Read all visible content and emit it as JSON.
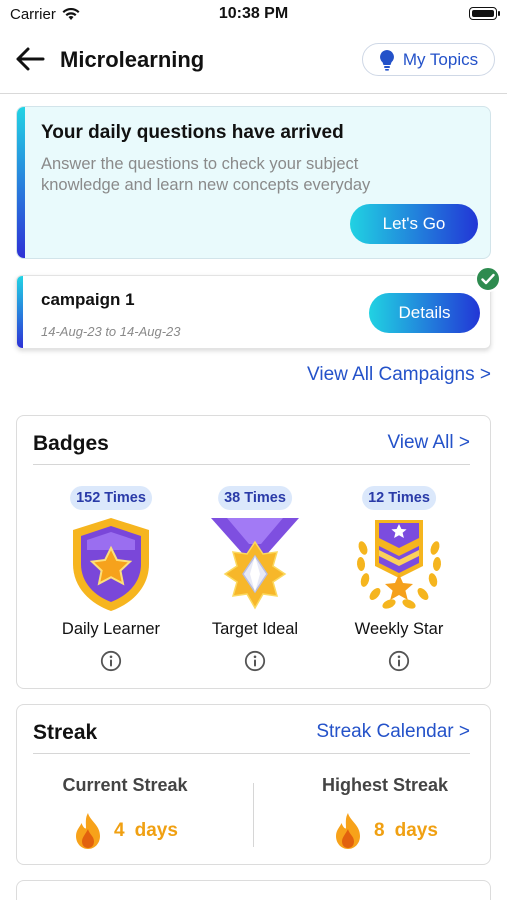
{
  "status_bar": {
    "carrier": "Carrier",
    "time": "10:38 PM"
  },
  "header": {
    "title": "Microlearning",
    "topics_label": "My Topics",
    "back_icon": "arrow-left-icon",
    "topics_icon": "lightbulb-icon"
  },
  "daily": {
    "title": "Your daily questions have arrived",
    "subtitle": "Answer the questions to check your subject knowledge and learn new concepts everyday",
    "button_label": "Let's Go"
  },
  "campaign": {
    "name": "campaign 1",
    "dates": "14-Aug-23 to 14-Aug-23",
    "button_label": "Details",
    "status_icon": "check-circle-icon"
  },
  "view_all_campaigns": "View All Campaigns >",
  "badges": {
    "title": "Badges",
    "view_all": "View All >",
    "items": [
      {
        "count": "152 Times",
        "name": "Daily Learner",
        "icon": "shield-star-badge-icon"
      },
      {
        "count": "38 Times",
        "name": "Target Ideal",
        "icon": "diamond-medal-badge-icon"
      },
      {
        "count": "12 Times",
        "name": "Weekly Star",
        "icon": "laurel-star-badge-icon"
      }
    ]
  },
  "streak": {
    "title": "Streak",
    "calendar_link": "Streak Calendar >",
    "current_label": "Current Streak",
    "current_value": "4",
    "current_unit": "days",
    "highest_label": "Highest Streak",
    "highest_value": "8",
    "highest_unit": "days"
  },
  "colors": {
    "accent_blue": "#2452c9",
    "gradient_start": "#21d2e2",
    "gradient_end": "#2236d6",
    "streak_orange": "#f0a012",
    "success_green": "#2e8b4f"
  }
}
